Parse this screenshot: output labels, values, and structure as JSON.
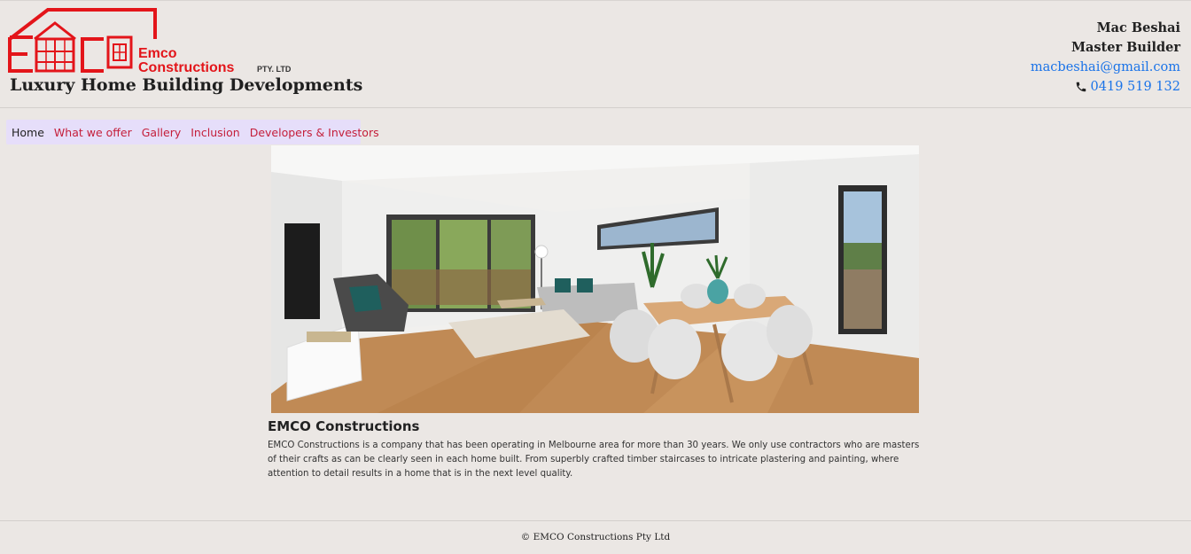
{
  "brand": {
    "logo_letters": "EMCO",
    "logo_word1": "Emco",
    "logo_word2": "Constructions",
    "logo_suffix": "PTY. LTD",
    "tagline": "Luxury Home Building Developments",
    "color": "#e3151a"
  },
  "contact": {
    "name": "Mac Beshai",
    "role": "Master Builder",
    "email": "macbeshai@gmail.com",
    "phone": "0419 519 132",
    "phone_icon": "phone-icon",
    "link_color": "#1a73e8"
  },
  "nav": {
    "items": [
      {
        "label": "Home",
        "active": true
      },
      {
        "label": "What we offer",
        "active": false
      },
      {
        "label": "Gallery",
        "active": false
      },
      {
        "label": "Inclusion",
        "active": false
      },
      {
        "label": "Developers & Investors",
        "active": false
      }
    ],
    "link_color": "#c41e3a",
    "background": "#e6defa"
  },
  "hero": {
    "image": "living-dining-room-photo"
  },
  "content": {
    "title": "EMCO Constructions",
    "body": "EMCO Constructions is a company that has been operating in Melbourne area for more than 30 years. We only use contractors who are masters of their crafts as can be clearly seen in each home built. From superbly crafted timber staircases to intricate plastering and painting, where attention to detail results in a home that is in the next level quality."
  },
  "footer": {
    "copyright": "© EMCO Constructions Pty Ltd"
  }
}
